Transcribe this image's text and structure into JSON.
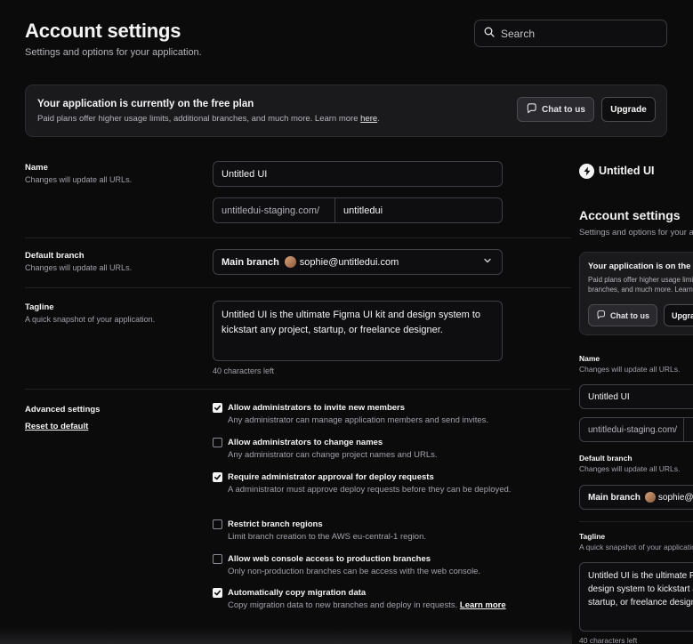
{
  "header": {
    "title": "Account settings",
    "subtitle": "Settings and options for your application.",
    "search_placeholder": "Search"
  },
  "banner": {
    "title": "Your application is currently on the free plan",
    "text": "Paid plans offer higher usage limits, additional branches, and much more. Learn more ",
    "link": "here",
    "link_suffix": ".",
    "chat_label": "Chat to us",
    "upgrade_label": "Upgrade"
  },
  "name": {
    "label": "Name",
    "hint": "Changes will update all URLs.",
    "value": "Untitled UI",
    "url_prefix": "untitledui-staging.com/",
    "url_value": "untitledui"
  },
  "branch": {
    "label": "Default branch",
    "hint": "Changes will update all URLs.",
    "value": "Main branch",
    "email": "sophie@untitledui.com"
  },
  "tagline": {
    "label": "Tagline",
    "hint": "A quick snapshot of your application.",
    "value": "Untitled UI is the ultimate Figma UI kit and design system to kickstart any project, startup, or freelance designer.",
    "counter": "40 characters left"
  },
  "advanced": {
    "label": "Advanced settings",
    "reset": "Reset to default",
    "options": [
      {
        "title": "Allow administrators to invite new members",
        "desc": "Any administrator can manage application members and send invites.",
        "checked": true
      },
      {
        "title": "Allow administrators to change names",
        "desc": "Any administrator can change project names and URLs.",
        "checked": false
      },
      {
        "title": "Require administrator approval for deploy requests",
        "desc": "A administrator must approve deploy requests before they can be deployed.",
        "checked": true
      },
      {
        "title": "Restrict branch regions",
        "desc": "Limit branch creation to the AWS eu-central-1 region.",
        "checked": false
      },
      {
        "title": "Allow web console access to production branches",
        "desc": "Only non-production branches can be access with the web console.",
        "checked": false
      },
      {
        "title": "Automatically copy migration data",
        "desc": "Copy migration data to new branches and deploy in requests. ",
        "link": "Learn more",
        "checked": true
      }
    ]
  },
  "preview": {
    "brand": "Untitled UI",
    "title": "Account settings",
    "subtitle": "Settings and options for your application.",
    "banner_title": "Your application is on the free plan",
    "banner_text_1": "Paid plans offer higher usage limits, additional",
    "banner_text_2": "branches, and much more. Learn more here.",
    "chat_label": "Chat to us",
    "upgrade_label": "Upgrade",
    "name_label": "Name",
    "name_hint": "Changes will update all URLs.",
    "name_value": "Untitled UI",
    "url_prefix": "untitledui-staging.com/",
    "branch_label": "Default branch",
    "branch_hint": "Changes will update all URLs.",
    "branch_value": "Main branch",
    "branch_email": "sophie@untitledui.com",
    "tagline_label": "Tagline",
    "tagline_hint": "A quick snapshot of your application.",
    "tagline_line_1": "Untitled UI is the ultimate Figma UI kit and",
    "tagline_line_2": "design system to kickstart any project,",
    "tagline_line_3": "startup, or freelance designer.",
    "counter": "40 characters left"
  },
  "colors": {
    "background": "#0b0b0c",
    "surface": "#1a1a1d",
    "border": "#3f3f46",
    "text": "#f4f4f5",
    "muted": "#a1a1aa"
  }
}
